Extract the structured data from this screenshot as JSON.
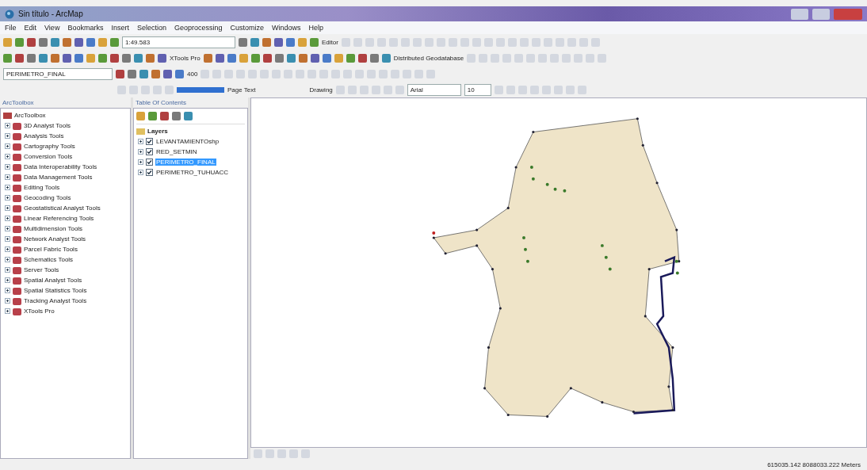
{
  "window": {
    "title": "Sin título - ArcMap"
  },
  "menu": [
    "File",
    "Edit",
    "View",
    "Bookmarks",
    "Insert",
    "Selection",
    "Geoprocessing",
    "Customize",
    "Windows",
    "Help"
  ],
  "toolbar": {
    "scale": "1:49.583",
    "editor": "Editor",
    "xtools": "XTools Pro",
    "geodatabase": "Distributed Geodatabase",
    "layer": "PERIMETRO_FINAL",
    "tolerance": "400",
    "page_text": "Page Text",
    "drawing": "Drawing",
    "font": "Arial",
    "font_size": "10"
  },
  "toolbox": {
    "title": "ArcToolbox",
    "root": "ArcToolbox",
    "items": [
      "3D Analyst Tools",
      "Analysis Tools",
      "Cartography Tools",
      "Conversion Tools",
      "Data Interoperability Tools",
      "Data Management Tools",
      "Editing Tools",
      "Geocoding Tools",
      "Geostatistical Analyst Tools",
      "Linear Referencing Tools",
      "Multidimension Tools",
      "Network Analyst Tools",
      "Parcel Fabric Tools",
      "Schematics Tools",
      "Server Tools",
      "Spatial Analyst Tools",
      "Spatial Statistics Tools",
      "Tracking Analyst Tools",
      "XTools Pro"
    ]
  },
  "toc": {
    "title": "Table Of Contents",
    "group": "Layers",
    "layers": [
      {
        "name": "LEVANTAMIENTOshp",
        "checked": true,
        "selected": false
      },
      {
        "name": "RED_SETMIN",
        "checked": true,
        "selected": false
      },
      {
        "name": "PERIMETRO_FINAL",
        "checked": true,
        "selected": true
      },
      {
        "name": "PERIMETRO_TUHUACC",
        "checked": true,
        "selected": false
      }
    ]
  },
  "status_bar": {
    "coordinates": "615035.142  8088033.222 Meters"
  }
}
